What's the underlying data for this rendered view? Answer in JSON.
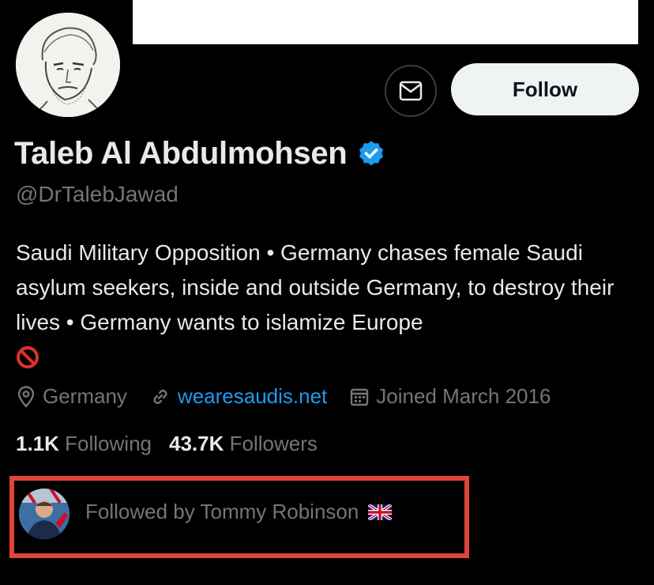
{
  "profile": {
    "name": "Taleb Al Abdulmohsen",
    "handle": "@DrTalebJawad",
    "bio": "Saudi Military Opposition • Germany chases female Saudi asylum seekers, inside and outside Germany, to destroy their lives • Germany wants to islamize Europe",
    "bio_emoji": "prohibited-icon",
    "verified": true,
    "location": "Germany",
    "website": "wearesaudis.net",
    "joined": "Joined March 2016"
  },
  "actions": {
    "message_icon": "envelope-icon",
    "follow_label": "Follow"
  },
  "stats": {
    "following_count": "1.1K",
    "following_label": "Following",
    "followers_count": "43.7K",
    "followers_label": "Followers"
  },
  "followed_by": {
    "text": "Followed by Tommy Robinson",
    "flag": "uk-flag-icon"
  },
  "colors": {
    "background": "#000000",
    "text_primary": "#e7e9ea",
    "text_secondary": "#71767b",
    "link": "#1d9bf0",
    "verified": "#1d9bf0",
    "follow_button_bg": "#eff3f4",
    "highlight_border": "#e0453c"
  }
}
